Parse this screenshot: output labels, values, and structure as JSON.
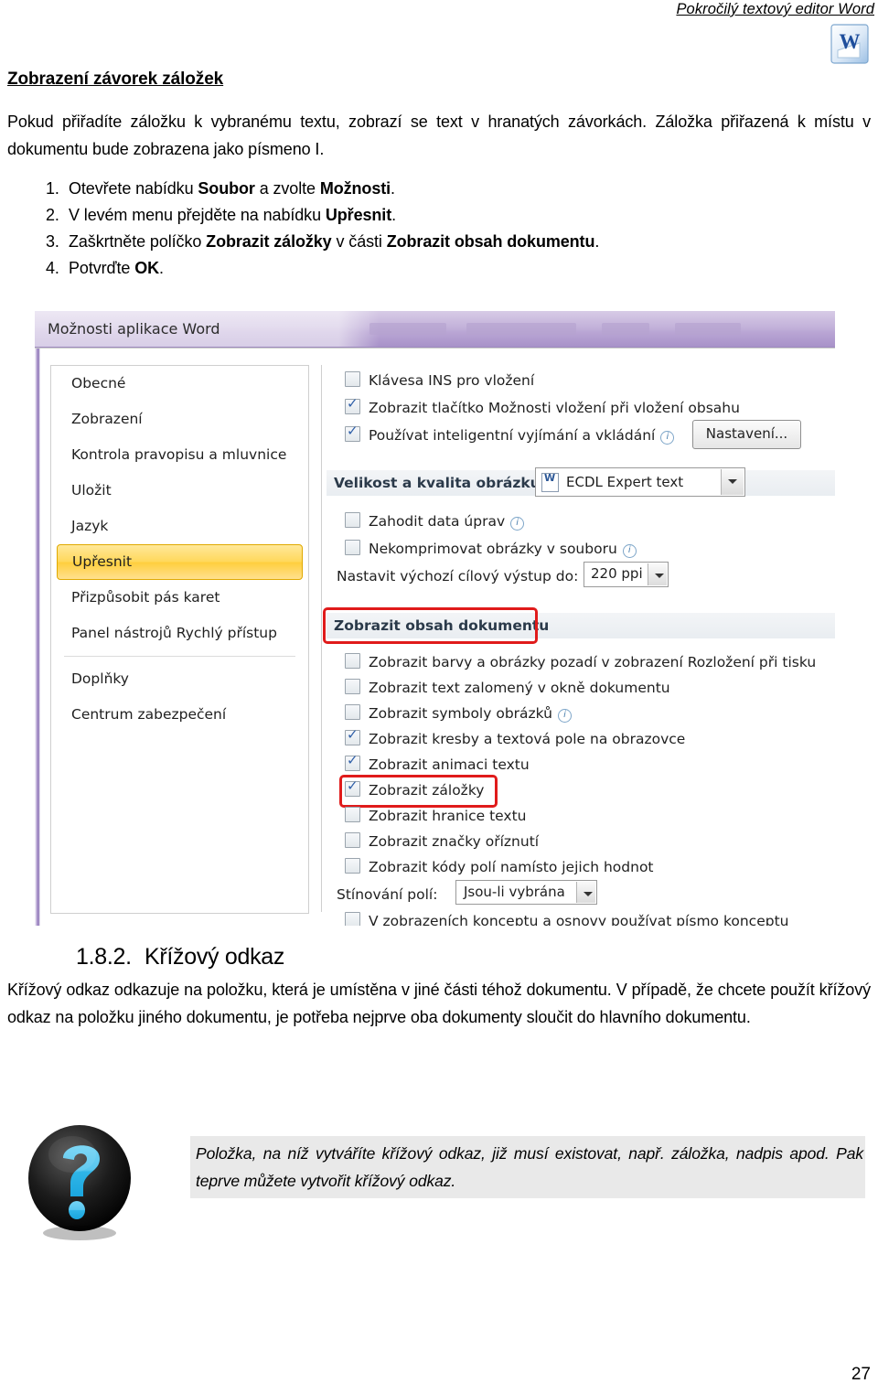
{
  "header": {
    "title": "Pokročilý textový editor Word",
    "logo_icon": "word-logo-icon"
  },
  "section": {
    "heading": "Zobrazení závorek záložek",
    "intro": "Pokud přiřadíte záložku k vybranému textu, zobrazí se text v hranatých závorkách. Záložka přiřazená k místu v dokumentu bude zobrazena jako písmeno I.",
    "steps": [
      {
        "num": "1.",
        "html": "Otevřete nabídku <b>Soubor</b> a zvolte <b>Možnosti</b>."
      },
      {
        "num": "2.",
        "html": "V levém menu přejděte na nabídku <b>Upřesnit</b>."
      },
      {
        "num": "3.",
        "html": "Zaškrtněte políčko <b>Zobrazit záložky</b> v části <b>Zobrazit obsah dokumentu</b>."
      },
      {
        "num": "4.",
        "html": "Potvrďte <b>OK</b>."
      }
    ]
  },
  "dialog": {
    "title": "Možnosti aplikace Word",
    "nav": [
      {
        "label": "Obecné",
        "selected": false
      },
      {
        "label": "Zobrazení",
        "selected": false
      },
      {
        "label": "Kontrola pravopisu a mluvnice",
        "selected": false
      },
      {
        "label": "Uložit",
        "selected": false
      },
      {
        "label": "Jazyk",
        "selected": false
      },
      {
        "label": "Upřesnit",
        "selected": true
      },
      {
        "label": "Přizpůsobit pás karet",
        "selected": false
      },
      {
        "label": "Panel nástrojů Rychlý přístup",
        "selected": false
      },
      {
        "label": "Doplňky",
        "selected": false
      },
      {
        "label": "Centrum zabezpečení",
        "selected": false
      }
    ],
    "cut_paste_options": [
      {
        "label": "Klávesa INS pro vložení",
        "checked": false,
        "info": false
      },
      {
        "label": "Zobrazit tlačítko Možnosti vložení při vložení obsahu",
        "checked": true,
        "info": false
      },
      {
        "label": "Používat inteligentní vyjímání a vkládání",
        "checked": true,
        "info": true
      }
    ],
    "settings_button": "Nastavení...",
    "image_group": {
      "heading": "Velikost a kvalita obrázku",
      "document_selector": "ECDL Expert text",
      "doc_icon": "word-document-icon",
      "options": [
        {
          "label": "Zahodit data úprav",
          "checked": false,
          "info": true
        },
        {
          "label": "Nekomprimovat obrázky v souboru",
          "checked": false,
          "info": true
        }
      ],
      "ppi_label": "Nastavit výchozí cílový výstup do:",
      "ppi_value": "220 ppi"
    },
    "show_content_group": {
      "heading": "Zobrazit obsah dokumentu",
      "highlighted": true,
      "options": [
        {
          "label": "Zobrazit barvy a obrázky pozadí v zobrazení Rozložení při tisku",
          "checked": false,
          "info": false,
          "highlighted": false
        },
        {
          "label": "Zobrazit text zalomený v okně dokumentu",
          "checked": false,
          "info": false,
          "highlighted": false
        },
        {
          "label": "Zobrazit symboly obrázků",
          "checked": false,
          "info": true,
          "highlighted": false
        },
        {
          "label": "Zobrazit kresby a textová pole na obrazovce",
          "checked": true,
          "info": false,
          "highlighted": false
        },
        {
          "label": "Zobrazit animaci textu",
          "checked": true,
          "info": false,
          "highlighted": false
        },
        {
          "label": "Zobrazit záložky",
          "checked": true,
          "info": false,
          "highlighted": true
        },
        {
          "label": "Zobrazit hranice textu",
          "checked": false,
          "info": false,
          "highlighted": false
        },
        {
          "label": "Zobrazit značky oříznutí",
          "checked": false,
          "info": false,
          "highlighted": false
        },
        {
          "label": "Zobrazit kódy polí namísto jejich hodnot",
          "checked": false,
          "info": false,
          "highlighted": false
        }
      ],
      "field_shading_label": "Stínování polí:",
      "field_shading_value": "Jsou-li vybrána",
      "draft_font": {
        "label": "V zobrazeních konceptu a osnovy používat písmo konceptu",
        "checked": false
      }
    },
    "highlight_color": "#e01b1b"
  },
  "subsection": {
    "number": "1.8.2.",
    "title": "Křížový odkaz",
    "body": "Křížový odkaz odkazuje na položku, která je umístěna v jiné části téhož dokumentu. V případě, že chcete použít křížový odkaz na položku jiného dokumentu, je potřeba nejprve oba dokumenty sloučit do hlavního dokumentu."
  },
  "note": {
    "icon": "question-mark-icon",
    "text": "Položka, na níž vytváříte křížový odkaz, již musí existovat, např. záložka, nadpis apod. Pak teprve můžete vytvořit křížový odkaz."
  },
  "footer": {
    "page_number": "27"
  }
}
